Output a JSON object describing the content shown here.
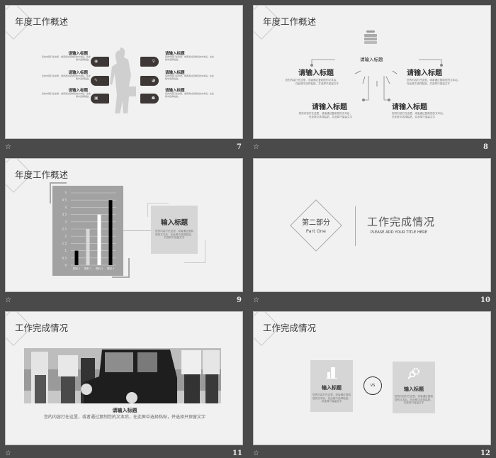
{
  "slides": [
    {
      "number": "7",
      "title": "年度工作概述",
      "item_title": "请输入标题",
      "item_desc": "您的内容打在这里，或者通过复制您的文本后，在此框中选择粘贴。"
    },
    {
      "number": "8",
      "title": "年度工作概述",
      "center_title": "请输入标题",
      "item_title": "请输入标题",
      "item_desc": "您的内容打在这里，或者通过复制您的文本后，在此框中选择粘贴，并选择只保留文字"
    },
    {
      "number": "9",
      "title": "年度工作概述",
      "box_title": "输入标题",
      "box_desc": "您的内容打在这里，或者通过复制您的文本后，在此框中选择粘贴，并选择只保留文字"
    },
    {
      "number": "10",
      "section_label": "第二部分",
      "section_sub": "Part One",
      "title": "工作完成情况",
      "subtitle": "PLEASE ADD YOUR TITLE HERE"
    },
    {
      "number": "11",
      "title": "工作完成情况",
      "item_title": "请输入标题",
      "item_desc": "您的内容打在这里，或者通过复制您的文本后，在此框中选择粘贴，并选择只保留文字"
    },
    {
      "number": "12",
      "title": "工作完成情况",
      "box_title": "输入标题",
      "box_desc": "您的内容打在这里，或者通过复制您的文本后，在此框中选择粘贴，并选择只保留文字",
      "vs": "VS"
    }
  ],
  "footer_icon": "star-transition-icon",
  "chart_data": {
    "type": "bar",
    "categories": [
      "类别 1",
      "类别 2",
      "类别 3",
      "类别 4"
    ],
    "values": [
      1,
      2.5,
      3.5,
      4.5
    ],
    "bar_colors": [
      "#000000",
      "#d9d9d9",
      "#ffffff",
      "#000000"
    ],
    "ylim": [
      0,
      5
    ],
    "yticks": [
      "0",
      "0.5",
      "1",
      "1.5",
      "2",
      "2.5",
      "3",
      "3.5",
      "4",
      "4.5",
      "5"
    ],
    "grid": true
  }
}
